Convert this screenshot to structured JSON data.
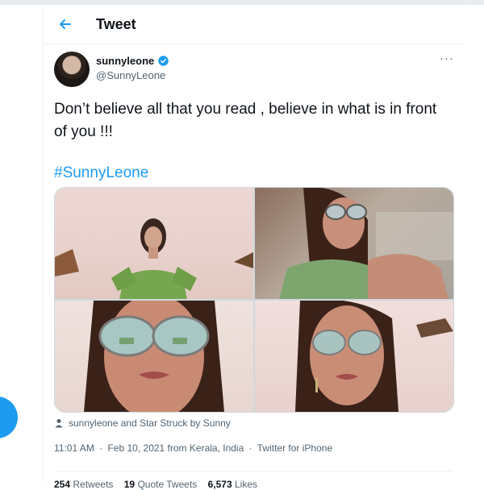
{
  "header": {
    "title": "Tweet",
    "back_icon": "arrow-left-icon"
  },
  "tweet": {
    "author": {
      "display_name": "sunnyleone",
      "handle": "@SunnyLeone",
      "verified": true
    },
    "more_label": "···",
    "text": "Don’t believe all that you read , believe in what is in front of you !!!",
    "hashtag": "#SunnyLeone",
    "media_count": 4,
    "tagged": "sunnyleone and Star Struck by Sunny",
    "meta": {
      "time": "11:01 AM",
      "date": "Feb 10, 2021 from Kerala, India",
      "source": "Twitter for iPhone",
      "separator": "·"
    },
    "stats": {
      "retweets": "254",
      "retweets_label": "Retweets",
      "quotes": "19",
      "quotes_label": "Quote Tweets",
      "likes": "6,573",
      "likes_label": "Likes"
    }
  },
  "colors": {
    "accent": "#1d9bf0",
    "text": "#0f1419",
    "secondary": "#536471",
    "border": "#eff3f4"
  }
}
